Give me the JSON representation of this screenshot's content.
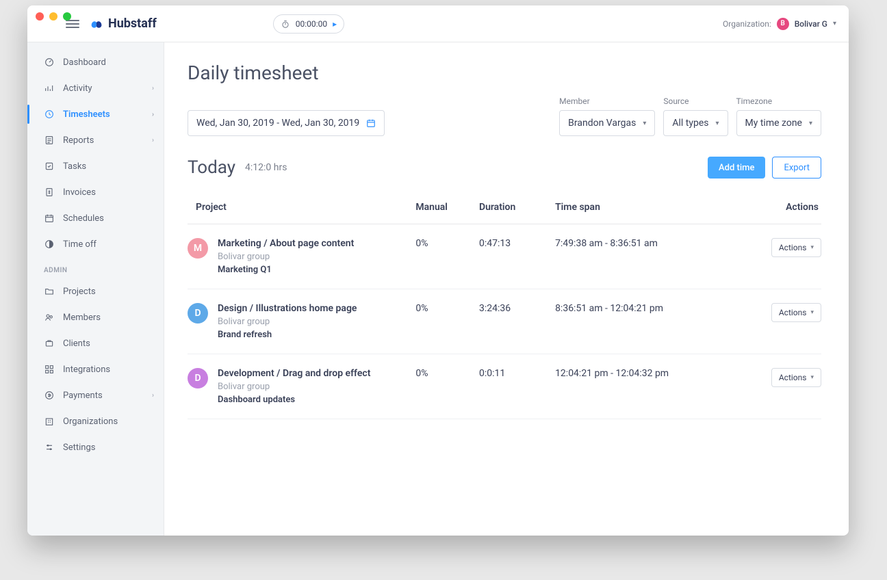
{
  "brand": "Hubstaff",
  "timer": "00:00:00",
  "org": {
    "label": "Organization:",
    "initial": "B",
    "name": "Bolivar G"
  },
  "sidebar": {
    "main": [
      {
        "label": "Dashboard",
        "expandable": false
      },
      {
        "label": "Activity",
        "expandable": true
      },
      {
        "label": "Timesheets",
        "expandable": true
      },
      {
        "label": "Reports",
        "expandable": true
      },
      {
        "label": "Tasks",
        "expandable": false
      },
      {
        "label": "Invoices",
        "expandable": false
      },
      {
        "label": "Schedules",
        "expandable": false
      },
      {
        "label": "Time off",
        "expandable": false
      }
    ],
    "adminLabel": "ADMIN",
    "admin": [
      {
        "label": "Projects",
        "expandable": false
      },
      {
        "label": "Members",
        "expandable": false
      },
      {
        "label": "Clients",
        "expandable": false
      },
      {
        "label": "Integrations",
        "expandable": false
      },
      {
        "label": "Payments",
        "expandable": true
      },
      {
        "label": "Organizations",
        "expandable": false
      },
      {
        "label": "Settings",
        "expandable": false
      }
    ]
  },
  "page": {
    "title": "Daily timesheet",
    "dateRange": "Wed, Jan 30, 2019 - Wed, Jan 30, 2019",
    "filters": {
      "memberLabel": "Member",
      "memberValue": "Brandon Vargas",
      "sourceLabel": "Source",
      "sourceValue": "All types",
      "timezoneLabel": "Timezone",
      "timezoneValue": "My time zone"
    },
    "todayTitle": "Today",
    "todayTotal": "4:12:0 hrs",
    "addTimeLabel": "Add time",
    "exportLabel": "Export"
  },
  "table": {
    "headers": {
      "project": "Project",
      "manual": "Manual",
      "duration": "Duration",
      "timespan": "Time span",
      "actions": "Actions"
    },
    "actionsBtn": "Actions",
    "rows": [
      {
        "avatarLetter": "M",
        "avatarColor": "#f39aa7",
        "project": "Marketing / About page content",
        "org": "Bolivar group",
        "task": "Marketing Q1",
        "manual": "0%",
        "duration": "0:47:13",
        "timespan": "7:49:38 am - 8:36:51 am"
      },
      {
        "avatarLetter": "D",
        "avatarColor": "#5ea9e8",
        "project": "Design / Illustrations home page",
        "org": "Bolivar group",
        "task": "Brand refresh",
        "manual": "0%",
        "duration": "3:24:36",
        "timespan": "8:36:51 am - 12:04:21 pm"
      },
      {
        "avatarLetter": "D",
        "avatarColor": "#c87fe0",
        "project": "Development / Drag and drop effect",
        "org": "Bolivar group",
        "task": "Dashboard updates",
        "manual": "0%",
        "duration": "0:0:11",
        "timespan": "12:04:21 pm - 12:04:32 pm"
      }
    ]
  }
}
